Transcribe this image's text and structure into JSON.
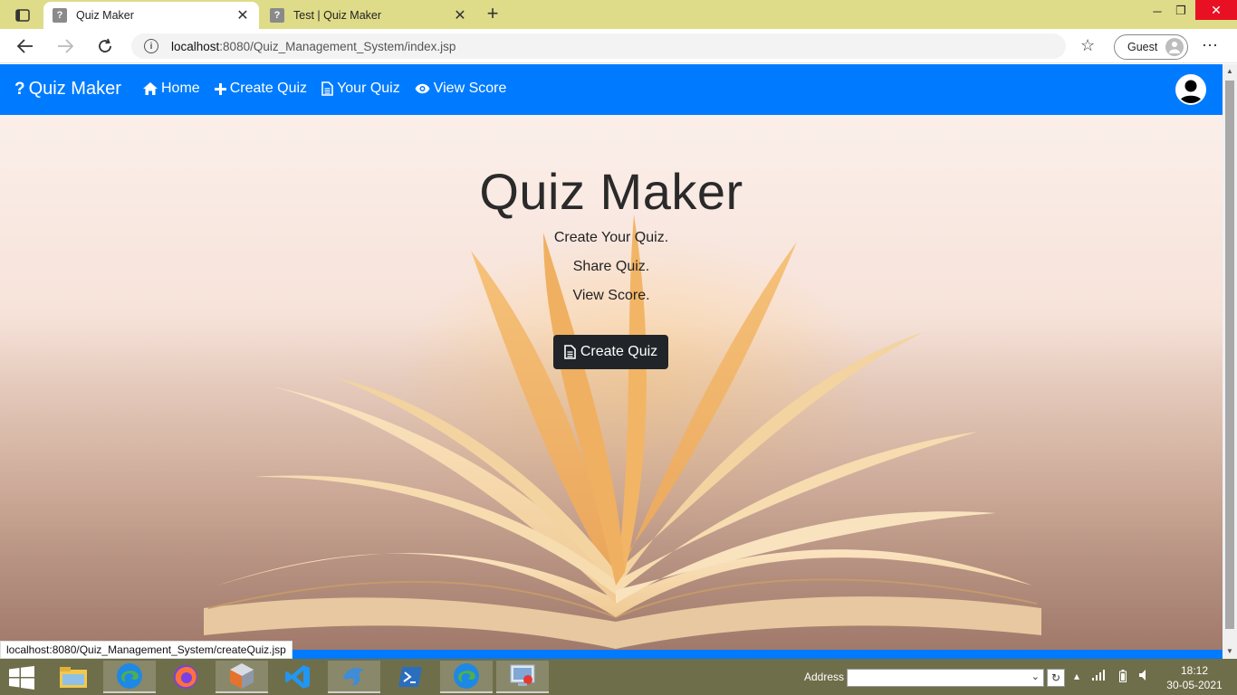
{
  "browser": {
    "tabs": [
      {
        "title": "Quiz Maker",
        "active": true,
        "favicon": "?"
      },
      {
        "title": "Test | Quiz Maker",
        "active": false,
        "favicon": "?"
      }
    ],
    "url": {
      "host": "localhost",
      "path": ":8080/Quiz_Management_System/index.jsp"
    },
    "profile_label": "Guest",
    "status_url": "localhost:8080/Quiz_Management_System/createQuiz.jsp"
  },
  "navbar": {
    "brand": "Quiz Maker",
    "links": [
      {
        "label": "Home",
        "icon": "home-icon"
      },
      {
        "label": "Create Quiz",
        "icon": "plus-icon"
      },
      {
        "label": "Your Quiz",
        "icon": "document-icon"
      },
      {
        "label": "View Score",
        "icon": "eye-icon"
      }
    ]
  },
  "hero": {
    "title": "Quiz Maker",
    "taglines": [
      "Create Your Quiz.",
      "Share Quiz.",
      "View Score."
    ],
    "cta_label": "Create Quiz"
  },
  "taskbar": {
    "address_label": "Address",
    "time": "18:12",
    "date": "30-05-2021"
  },
  "colors": {
    "navbar": "#007bff",
    "cta": "#212529",
    "tabbar": "#dfdc89",
    "taskbar": "#6f6e4a"
  }
}
